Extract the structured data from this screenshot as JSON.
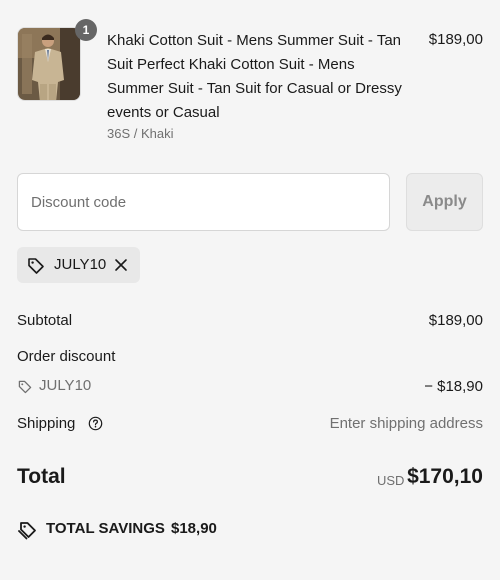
{
  "product": {
    "title": "Khaki Cotton Suit - Mens Summer Suit - Tan Suit Perfect Khaki Cotton Suit - Mens Summer Suit - Tan Suit for Casual or Dressy events or Casual",
    "variant": "36S / Khaki",
    "price": "$189,00",
    "quantity": "1",
    "image_icon": "suit-photo"
  },
  "discount": {
    "placeholder": "Discount code",
    "value": "",
    "apply_label": "Apply",
    "applied_code": "JULY10"
  },
  "summary": {
    "subtotal_label": "Subtotal",
    "subtotal_value": "$189,00",
    "order_discount_label": "Order discount",
    "discount_code": "JULY10",
    "discount_value": "− $18,90",
    "shipping_label": "Shipping",
    "shipping_value": "Enter shipping address",
    "total_label": "Total",
    "currency": "USD",
    "total_value": "$170,10",
    "savings_label": "TOTAL SAVINGS",
    "savings_value": "$18,90"
  },
  "colors": {
    "background": "#f5f5f5",
    "text": "#1a1a1a",
    "muted": "#707070",
    "chip": "#e8e8e8",
    "badge": "#666666"
  }
}
